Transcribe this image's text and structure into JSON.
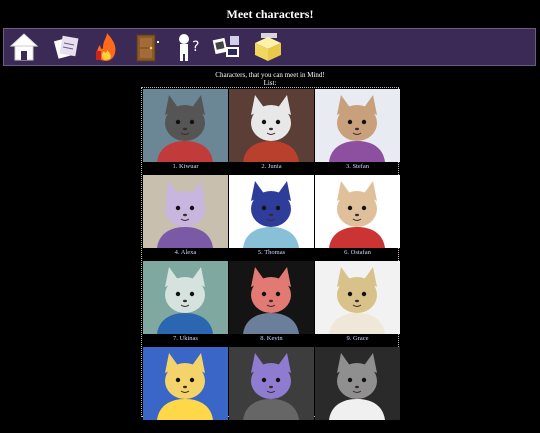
{
  "page": {
    "title": "Meet characters!"
  },
  "nav": {
    "items": [
      {
        "name": "home-icon"
      },
      {
        "name": "papers-icon"
      },
      {
        "name": "fire-icon"
      },
      {
        "name": "door-icon"
      },
      {
        "name": "question-character-icon"
      },
      {
        "name": "photos-icon"
      },
      {
        "name": "box-icon"
      }
    ]
  },
  "intro": {
    "line1": "Characters, that you can meet in Mind!",
    "line2": "List:"
  },
  "characters": [
    {
      "label": "1. Kiwuar",
      "bg": "#6b8796",
      "fur": "#555",
      "accent": "#c23b3b"
    },
    {
      "label": "2. Junia",
      "bg": "#5b3f36",
      "fur": "#e8e8e8",
      "accent": "#b8402d"
    },
    {
      "label": "3. Stefan",
      "bg": "#e8ebf1",
      "fur": "#c8a07c",
      "accent": "#8d4fa0"
    },
    {
      "label": "4. Alexa",
      "bg": "#c8bfae",
      "fur": "#c8b6df",
      "accent": "#7a5aa6"
    },
    {
      "label": "5. Thomas",
      "bg": "#ffffff",
      "fur": "#2f3d9a",
      "accent": "#88c0d8"
    },
    {
      "label": "6. Ostafan",
      "bg": "#ffffff",
      "fur": "#e0c09a",
      "accent": "#cc3333"
    },
    {
      "label": "7. Ukinas",
      "bg": "#7fa8a0",
      "fur": "#d6e2de",
      "accent": "#2b66b0"
    },
    {
      "label": "8. Kevin",
      "bg": "#141414",
      "fur": "#e07a72",
      "accent": "#6b7f9a"
    },
    {
      "label": "9. Grace",
      "bg": "#f2f2f2",
      "fur": "#d9c18a",
      "accent": "#efe7d7"
    },
    {
      "label": "",
      "bg": "#3a66c8",
      "fur": "#f3d36a",
      "accent": "#ffd84a"
    },
    {
      "label": "",
      "bg": "#3d3d3d",
      "fur": "#8f7bd0",
      "accent": "#666"
    },
    {
      "label": "",
      "bg": "#2a2a2a",
      "fur": "#8f8f8f",
      "accent": "#f0f0f0"
    }
  ]
}
